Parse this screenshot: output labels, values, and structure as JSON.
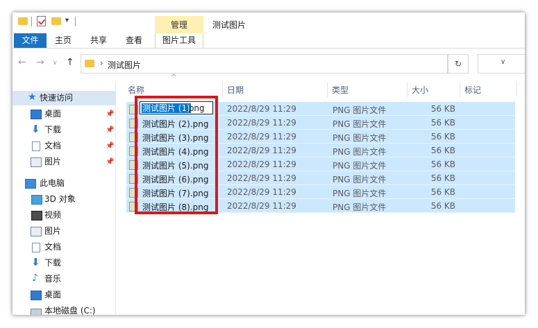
{
  "window": {
    "title": "测试图片",
    "contextual_tab_group": "管理"
  },
  "ribbon": {
    "tabs": [
      {
        "label": "文件"
      },
      {
        "label": "主页"
      },
      {
        "label": "共享"
      },
      {
        "label": "查看"
      },
      {
        "label": "图片工具"
      }
    ]
  },
  "address_bar": {
    "path": "测试图片",
    "chevron": "›",
    "dropdown_icon": "chevron-down-icon",
    "refresh_icon": "refresh-icon"
  },
  "sidebar": {
    "items": [
      {
        "label": "快速访问",
        "icon": "star-icon",
        "pinned": false
      },
      {
        "label": "桌面",
        "icon": "desktop-icon",
        "pinned": true
      },
      {
        "label": "下载",
        "icon": "download-icon",
        "pinned": true
      },
      {
        "label": "文档",
        "icon": "document-icon",
        "pinned": true
      },
      {
        "label": "图片",
        "icon": "pictures-icon",
        "pinned": true
      },
      {
        "label": "此电脑",
        "icon": "computer-icon",
        "pinned": false
      },
      {
        "label": "3D 对象",
        "icon": "3d-objects-icon",
        "pinned": false
      },
      {
        "label": "视频",
        "icon": "video-icon",
        "pinned": false
      },
      {
        "label": "图片",
        "icon": "pictures-icon",
        "pinned": false
      },
      {
        "label": "文档",
        "icon": "document-icon",
        "pinned": false
      },
      {
        "label": "下载",
        "icon": "download-icon",
        "pinned": false
      },
      {
        "label": "音乐",
        "icon": "music-icon",
        "pinned": false
      },
      {
        "label": "桌面",
        "icon": "desktop-icon",
        "pinned": false
      },
      {
        "label": "本地磁盘 (C:)",
        "icon": "disk-icon",
        "pinned": false
      }
    ]
  },
  "file_list": {
    "columns": {
      "name": "名称",
      "date": "日期",
      "type": "类型",
      "size": "大小",
      "tags": "标记"
    },
    "rename": {
      "selected_part": "测试图片 (1)",
      "extension": ".png"
    },
    "files": [
      {
        "name": "测试图片 (1).png",
        "date": "2022/8/29 11:29",
        "type": "PNG 图片文件",
        "size": "56 KB"
      },
      {
        "name": "测试图片 (2).png",
        "date": "2022/8/29 11:29",
        "type": "PNG 图片文件",
        "size": "56 KB"
      },
      {
        "name": "测试图片 (3).png",
        "date": "2022/8/29 11:29",
        "type": "PNG 图片文件",
        "size": "56 KB"
      },
      {
        "name": "测试图片 (4).png",
        "date": "2022/8/29 11:29",
        "type": "PNG 图片文件",
        "size": "56 KB"
      },
      {
        "name": "测试图片 (5).png",
        "date": "2022/8/29 11:29",
        "type": "PNG 图片文件",
        "size": "56 KB"
      },
      {
        "name": "测试图片 (6).png",
        "date": "2022/8/29 11:29",
        "type": "PNG 图片文件",
        "size": "56 KB"
      },
      {
        "name": "测试图片 (7).png",
        "date": "2022/8/29 11:29",
        "type": "PNG 图片文件",
        "size": "56 KB"
      },
      {
        "name": "测试图片 (8).png",
        "date": "2022/8/29 11:29",
        "type": "PNG 图片文件",
        "size": "56 KB"
      }
    ]
  },
  "colors": {
    "selection": "#cce8ff",
    "accent": "#0078d7",
    "annotation": "#e3141b"
  }
}
